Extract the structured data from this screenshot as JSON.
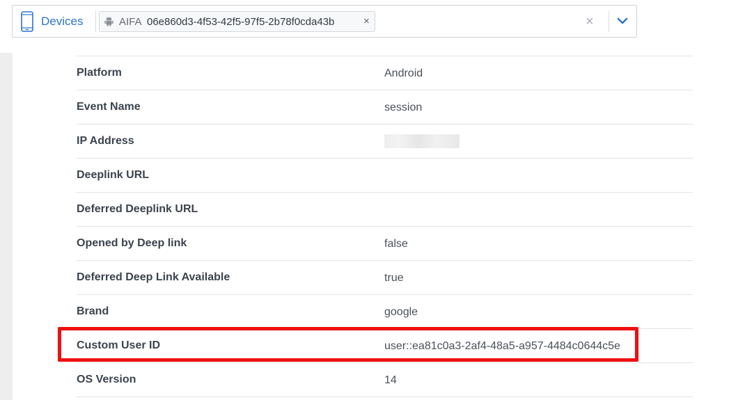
{
  "filter": {
    "category_label": "Devices",
    "chip_type": "AIFA",
    "chip_value": "06e860d3-4f53-42f5-97f5-2b78f0cda43b",
    "chip_remove_glyph": "×",
    "clear_glyph": "×",
    "icons": {
      "category": "mobile-device-icon",
      "chip": "android-icon",
      "clear": "clear-icon",
      "expand": "chevron-down-icon"
    }
  },
  "details": {
    "rows": [
      {
        "label": "Platform",
        "value": "Android"
      },
      {
        "label": "Event Name",
        "value": "session"
      },
      {
        "label": "IP Address",
        "value": "",
        "redacted": true
      },
      {
        "label": "Deeplink URL",
        "value": ""
      },
      {
        "label": "Deferred Deeplink URL",
        "value": ""
      },
      {
        "label": "Opened by Deep link",
        "value": "false"
      },
      {
        "label": "Deferred Deep Link Available",
        "value": "true"
      },
      {
        "label": "Brand",
        "value": "google"
      },
      {
        "label": "Custom User ID",
        "value": "user::ea81c0a3-2af4-48a5-a957-4484c0644c5e",
        "highlighted": true
      },
      {
        "label": "OS Version",
        "value": "14"
      }
    ]
  },
  "colors": {
    "accent": "#2d74c8",
    "highlight": "#ee1111",
    "label_text": "#3c434d",
    "value_text": "#4a5058",
    "divider": "#e2e4e7"
  }
}
